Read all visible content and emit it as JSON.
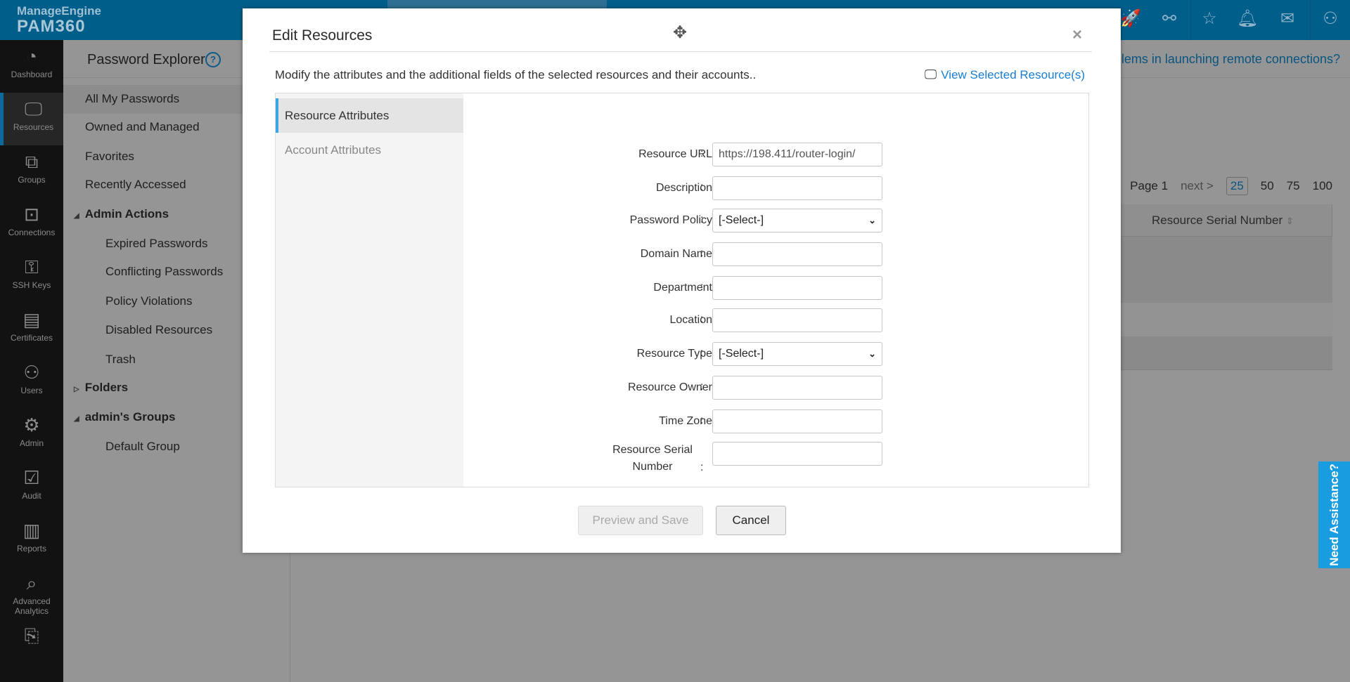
{
  "header": {
    "brand": "ManageEngine",
    "product": "PAM360",
    "icons": [
      "rocket-icon",
      "link-icon",
      "user-star-icon",
      "bell-icon",
      "mail-icon",
      "user-icon"
    ]
  },
  "sidebar": {
    "items": [
      {
        "label": "Dashboard",
        "icon": "◔"
      },
      {
        "label": "Resources",
        "icon": "🖵"
      },
      {
        "label": "Groups",
        "icon": "⧉"
      },
      {
        "label": "Connections",
        "icon": "⊡"
      },
      {
        "label": "SSH Keys",
        "icon": "⚿"
      },
      {
        "label": "Certificates",
        "icon": "▤"
      },
      {
        "label": "Users",
        "icon": "⚇"
      },
      {
        "label": "Admin",
        "icon": "⚙"
      },
      {
        "label": "Audit",
        "icon": "☑"
      },
      {
        "label": "Reports",
        "icon": "▥"
      },
      {
        "label": "Advanced Analytics",
        "icon": "⌕"
      },
      {
        "label": "",
        "icon": "⎘"
      }
    ]
  },
  "panel": {
    "title": "Password Explorer",
    "help": "?",
    "items": [
      "All My Passwords",
      "Owned and Managed",
      "Favorites",
      "Recently Accessed"
    ],
    "admin_actions": {
      "label": "Admin Actions",
      "items": [
        "Expired Passwords",
        "Conflicting Passwords",
        "Policy Violations",
        "Disabled Resources",
        "Trash"
      ]
    },
    "folders": "Folders",
    "groups": {
      "label": "admin's Groups",
      "items": [
        "Default Group"
      ]
    }
  },
  "main": {
    "banner": "Problems in launching remote connections?",
    "pager": {
      "page": "Page 1",
      "next": "next >",
      "sizes": [
        "25",
        "50",
        "75",
        "100"
      ]
    },
    "column": "Resource Serial Number"
  },
  "modal": {
    "title": "Edit Resources",
    "close": "×",
    "description": "Modify the attributes and the additional fields of the selected resources and their accounts..",
    "view_link": "View Selected Resource(s)",
    "tabs": [
      "Resource Attributes",
      "Account Attributes"
    ],
    "fields": [
      {
        "label": "Resource URL",
        "value": "https://198.411/router-login/"
      },
      {
        "label": "Description",
        "value": ""
      },
      {
        "label": "Password Policy",
        "value": "[-Select-]"
      },
      {
        "label": "Domain Name",
        "value": ""
      },
      {
        "label": "Department",
        "value": ""
      },
      {
        "label": "Location",
        "value": ""
      },
      {
        "label": "Resource Type",
        "value": "[-Select-]"
      },
      {
        "label": "Resource Owner",
        "value": ""
      },
      {
        "label": "Time Zone",
        "value": ""
      },
      {
        "label": "Resource Serial Number",
        "value": ""
      }
    ],
    "preview": "Preview and Save",
    "cancel": "Cancel"
  },
  "assist": "Need Assistance?"
}
